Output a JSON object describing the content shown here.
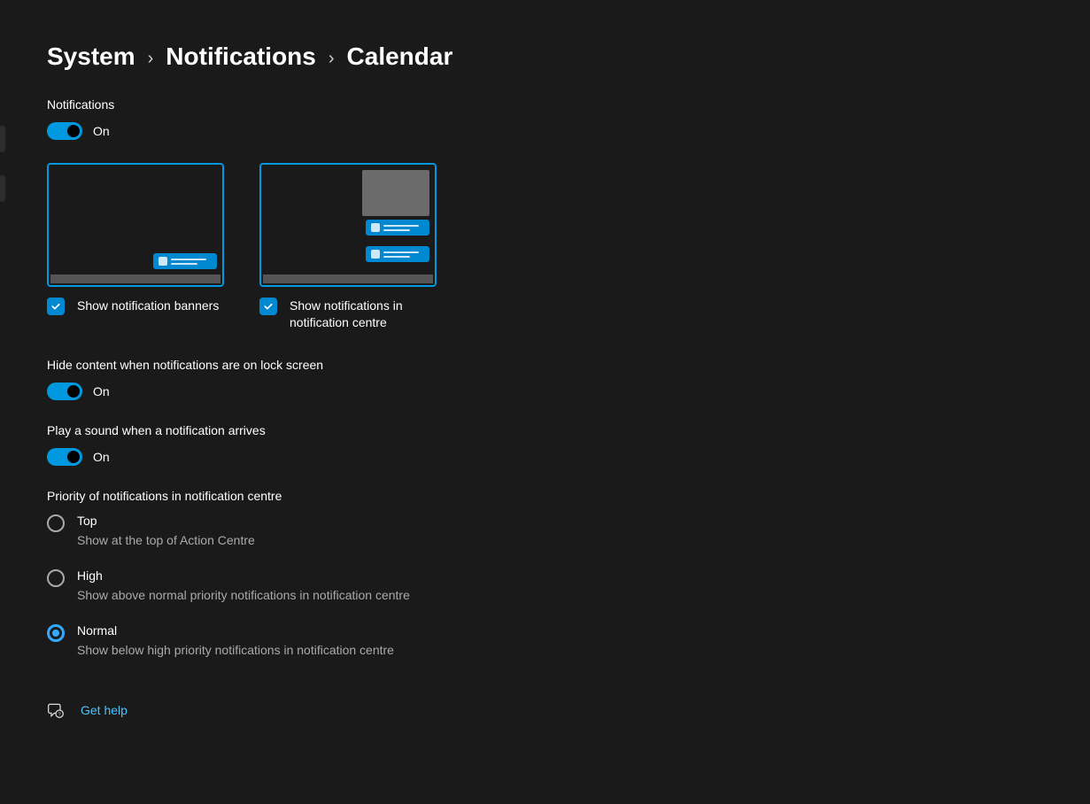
{
  "breadcrumb": {
    "item1": "System",
    "item2": "Notifications",
    "item3": "Calendar"
  },
  "notifications": {
    "label": "Notifications",
    "toggle_state": "On"
  },
  "banner_option": {
    "label": "Show notification banners"
  },
  "centre_option": {
    "label": "Show notifications in notification centre"
  },
  "hide_content": {
    "label": "Hide content when notifications are on lock screen",
    "state": "On"
  },
  "play_sound": {
    "label": "Play a sound when a notification arrives",
    "state": "On"
  },
  "priority": {
    "label": "Priority of notifications in notification centre",
    "options": [
      {
        "title": "Top",
        "desc": "Show at the top of Action Centre",
        "selected": false
      },
      {
        "title": "High",
        "desc": "Show above normal priority notifications in notification centre",
        "selected": false
      },
      {
        "title": "Normal",
        "desc": "Show below high priority notifications in notification centre",
        "selected": true
      }
    ]
  },
  "help": {
    "label": "Get help"
  }
}
